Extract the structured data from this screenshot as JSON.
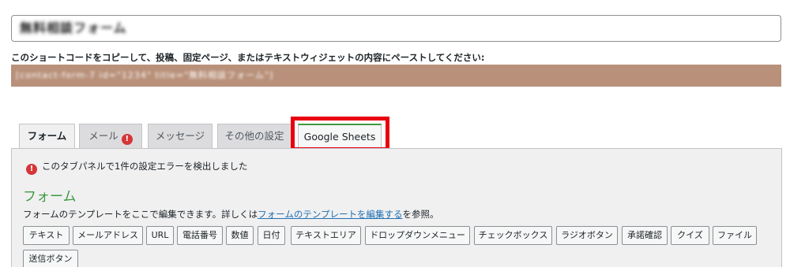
{
  "form_title": "無料相談フォーム",
  "shortcode_label": "このショートコードをコピーして、投稿、固定ページ、またはテキストウィジェットの内容にペーストしてください:",
  "shortcode_value": "[contact-form-7 id=\"1234\" title=\"無料相談フォーム\"]",
  "tabs": [
    {
      "label": "フォーム",
      "active": true
    },
    {
      "label": "メール",
      "error": "!"
    },
    {
      "label": "メッセージ"
    },
    {
      "label": "その他の設定"
    },
    {
      "label": "Google Sheets",
      "highlighted": true
    }
  ],
  "panel": {
    "error_icon": "!",
    "error_message": "このタブパネルで1件の設定エラーを検出しました",
    "heading": "フォーム",
    "desc_before": "フォームのテンプレートをここで編集できます。詳しくは",
    "desc_link": "フォームのテンプレートを編集する",
    "desc_after": "を参照。",
    "tags": [
      "テキスト",
      "メールアドレス",
      "URL",
      "電話番号",
      "数値",
      "日付",
      "テキストエリア",
      "ドロップダウンメニュー",
      "チェックボックス",
      "ラジオボタン",
      "承諾確認",
      "クイズ",
      "ファイル",
      "送信ボタン"
    ]
  },
  "colors": {
    "accent_green": "#3d9a40",
    "error_red": "#d63638",
    "highlight_red": "#e8000f",
    "shortcode_bg": "#b9917a"
  }
}
